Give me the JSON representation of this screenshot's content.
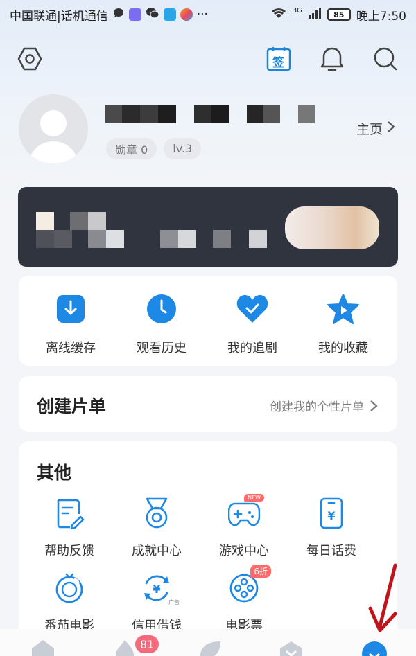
{
  "status_bar": {
    "carrier": "中国联通|话机通信",
    "network": "3G",
    "battery": "85",
    "time": "晚上7:50"
  },
  "toolbar": {
    "settings_icon": "hexagon-settings-icon",
    "checkin_label": "签",
    "notification_icon": "bell-icon",
    "search_icon": "search-icon"
  },
  "profile": {
    "medal_badge": "勋章 0",
    "level_badge": "lv.3",
    "homepage_label": "主页"
  },
  "quick_actions": [
    {
      "label": "离线缓存",
      "icon": "download-icon"
    },
    {
      "label": "观看历史",
      "icon": "clock-icon"
    },
    {
      "label": "我的追剧",
      "icon": "heart-check-icon"
    },
    {
      "label": "我的收藏",
      "icon": "star-icon"
    }
  ],
  "playlist": {
    "title": "创建片单",
    "link": "创建我的个性片单"
  },
  "other": {
    "title": "其他",
    "tools": [
      {
        "label": "帮助反馈",
        "icon": "feedback-icon"
      },
      {
        "label": "成就中心",
        "icon": "medal-icon"
      },
      {
        "label": "游戏中心",
        "icon": "gamepad-icon",
        "tag": "NEW"
      },
      {
        "label": "每日话费",
        "icon": "phone-yuan-icon"
      },
      {
        "label": "番茄电影",
        "icon": "tomato-icon"
      },
      {
        "label": "信用借钱",
        "icon": "yuan-loan-icon",
        "tag": "广告"
      },
      {
        "label": "电影票",
        "icon": "film-reel-icon",
        "tag": "6折"
      }
    ]
  },
  "bottom_nav": {
    "badge_count": "81",
    "items": [
      "home-icon",
      "fire-icon",
      "leaf-icon",
      "vip-icon",
      "profile-icon"
    ]
  },
  "colors": {
    "accent": "#1e88e5",
    "banner": "#30343f",
    "badge_red": "#f46a7a",
    "annotation_arrow": "#c0141b"
  }
}
